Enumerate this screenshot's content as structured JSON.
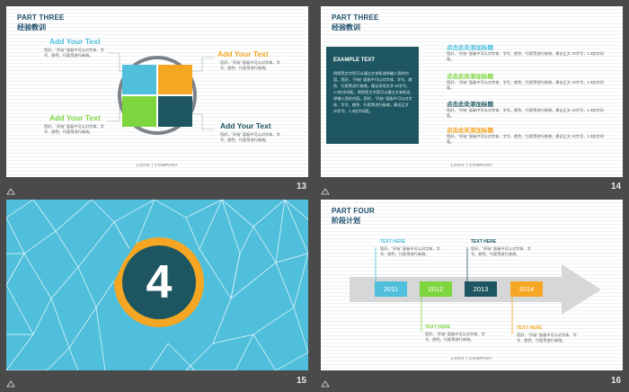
{
  "slide13": {
    "part": "PART THREE",
    "subtitle": "经验教训",
    "add_tl": "Add Your Text",
    "add_tr": "Add Your Text",
    "add_bl": "Add Your Text",
    "add_br": "Add Your Text",
    "body": "您好，“开始” 面板中可以对字体、字号、颜色、行距等进行修改。",
    "logo": "LOGO  |  COMPANY",
    "number": "13",
    "pie_colors": [
      "#f5a623",
      "#1d5660",
      "#7ed63f",
      "#4fbfdc"
    ]
  },
  "slide14": {
    "part": "PART THREE",
    "subtitle": "经验教训",
    "example_title": "EXAMPLE TEXT",
    "example_body": "例您您文字您可以通过文本框选择输入您的内容。您好，“开始” 面板中可以对字体、字号、颜色、行距等进行修改。建议采用文字 10字号，1.3倍字间距，例您您文字您可以通过文本框选择输入您的内容。您好，“开始” 面板中可以对字体、字号、颜色、行距等进行修改。建议正文 10字号，1.3倍字间距。",
    "items": [
      {
        "heading": "点击此处添加标题",
        "color": "#4fbfdc",
        "text": "您好，“开始” 面板中可以对字体、字号、颜色、行距等进行修改。建议正文 10字号，1.3倍字间距。"
      },
      {
        "heading": "点击此处添加标题",
        "color": "#7ed63f",
        "text": "您好，“开始” 面板中可以对字体、字号、颜色、行距等进行修改。建议正文 10字号，1.3倍字间距。"
      },
      {
        "heading": "点击此处添加标题",
        "color": "#1d5660",
        "text": "您好，“开始” 面板中可以对字体、字号、颜色、行距等进行修改。建议正文 10字号，1.3倍字间距。"
      },
      {
        "heading": "点击此处添加标题",
        "color": "#f5a623",
        "text": "您好，“开始” 面板中可以对字体、字号、颜色、行距等进行修改。建议正文 10字号，1.3倍字间距。"
      }
    ],
    "logo": "LOGO  |  COMPANY",
    "number": "14"
  },
  "slide15": {
    "big_number": "4",
    "number": "15"
  },
  "slide16": {
    "part": "PART FOUR",
    "subtitle": "阶段计划",
    "top1_head": "TEXT HERE",
    "top2_head": "TEXT HERE",
    "bot1_head": "TEXT HERE",
    "bot2_head": "TEXT HERE",
    "body": "您好，“开始” 面板中可以对字体、字号、颜色、行距等进行修改。",
    "years": [
      "2011",
      "2012",
      "2013",
      "2014"
    ],
    "logo": "LOGO  |  COMPANY",
    "number": "16"
  },
  "colors": {
    "blue": "#4fbfdc",
    "green": "#7ed63f",
    "teal": "#1d5660",
    "orange": "#f5a623"
  }
}
